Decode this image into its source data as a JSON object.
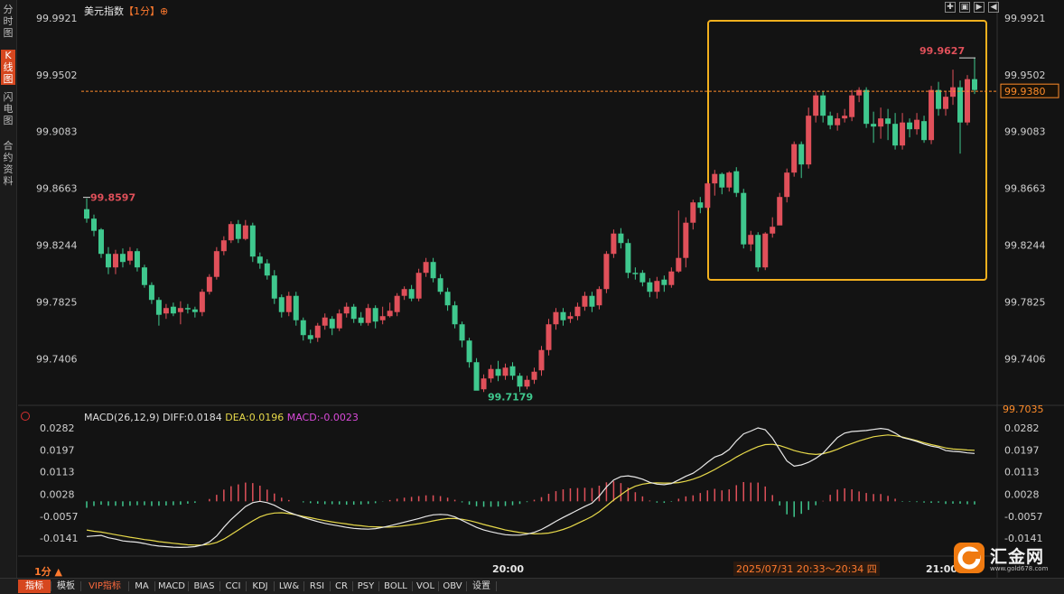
{
  "sidebar": {
    "tabs": [
      {
        "label": "分时图",
        "active": false
      },
      {
        "label": "K线图",
        "active": true
      },
      {
        "label": "闪电图",
        "active": false
      },
      {
        "label": "合约资料",
        "active": false
      }
    ]
  },
  "header": {
    "instrument": "美元指数",
    "period": "【1分】",
    "plus": "⊕"
  },
  "toolbar": {
    "icons": [
      "expand-icon",
      "shrink-icon",
      "play-icon",
      "previous-icon"
    ]
  },
  "price_axis": {
    "labels": [
      "99.9921",
      "99.9502",
      "99.9083",
      "99.8663",
      "99.8244",
      "99.7825",
      "99.7406"
    ],
    "last_price": "99.9380",
    "bottom_price": "99.7035"
  },
  "annotations": {
    "high": "99.9627",
    "mid_high": "99.8597",
    "low": "99.7179"
  },
  "macd": {
    "name": "MACD(26,12,9)",
    "diff": "DIFF:0.0184",
    "dea": "DEA:0.0196",
    "macd": "MACD:-0.0023",
    "axis_labels": [
      "0.0282",
      "0.0197",
      "0.0113",
      "0.0028",
      "-0.0057",
      "-0.0141"
    ]
  },
  "time_axis": {
    "labels": [
      "20:00",
      "21:00"
    ],
    "range": "2025/07/31 20:33～20:34 四",
    "period": "1分 ▲"
  },
  "bottom_bar": {
    "items": [
      "指标",
      "模板",
      "VIP指标",
      "MA",
      "MACD",
      "BIAS",
      "CCI",
      "KDJ",
      "LW&",
      "RSI",
      "CR",
      "PSY",
      "BOLL",
      "VOL",
      "OBV",
      "设置"
    ]
  },
  "logo": {
    "text": "汇金网",
    "url": "www.gold678.com"
  },
  "colors": {
    "up": "#e0505a",
    "down": "#3fc88e",
    "dashed_price": "#ff8c2a",
    "highlight_box": "#f2b01e",
    "diff_line": "#e8e8e8",
    "dea_line": "#e7d94a"
  },
  "chart_data": {
    "type": "candlestick",
    "price_range": [
      99.7035,
      99.9921
    ],
    "macd_range": [
      -0.0141,
      0.0282
    ],
    "candles": [
      [
        99.851,
        99.844,
        99.859,
        99.841
      ],
      [
        99.844,
        99.835,
        99.847,
        99.831
      ],
      [
        99.836,
        99.818,
        99.837,
        99.815
      ],
      [
        99.818,
        99.808,
        99.823,
        99.803
      ],
      [
        99.808,
        99.818,
        99.821,
        99.803
      ],
      [
        99.818,
        99.812,
        99.822,
        99.808
      ],
      [
        99.813,
        99.82,
        99.823,
        99.81
      ],
      [
        99.82,
        99.808,
        99.822,
        99.805
      ],
      [
        99.808,
        99.795,
        99.81,
        99.793
      ],
      [
        99.795,
        99.784,
        99.797,
        99.781
      ],
      [
        99.784,
        99.773,
        99.786,
        99.765
      ],
      [
        99.774,
        99.778,
        99.781,
        99.77
      ],
      [
        99.779,
        99.774,
        99.782,
        99.772
      ],
      [
        99.775,
        99.778,
        99.783,
        99.766
      ],
      [
        99.778,
        99.777,
        99.781,
        99.774
      ],
      [
        99.777,
        99.775,
        99.779,
        99.771
      ],
      [
        99.775,
        99.79,
        99.792,
        99.772
      ],
      [
        99.79,
        99.801,
        99.803,
        99.788
      ],
      [
        99.801,
        99.82,
        99.823,
        99.799
      ],
      [
        99.82,
        99.828,
        99.831,
        99.817
      ],
      [
        99.828,
        99.84,
        99.842,
        99.826
      ],
      [
        99.84,
        99.829,
        99.843,
        99.826
      ],
      [
        99.829,
        99.839,
        99.843,
        99.828
      ],
      [
        99.839,
        99.816,
        99.841,
        99.812
      ],
      [
        99.816,
        99.811,
        99.819,
        99.807
      ],
      [
        99.811,
        99.802,
        99.814,
        99.799
      ],
      [
        99.802,
        99.785,
        99.806,
        99.781
      ],
      [
        99.786,
        99.775,
        99.788,
        99.771
      ],
      [
        99.775,
        99.787,
        99.79,
        99.772
      ],
      [
        99.787,
        99.769,
        99.79,
        99.765
      ],
      [
        99.769,
        99.758,
        99.771,
        99.754
      ],
      [
        99.758,
        99.755,
        99.762,
        99.752
      ],
      [
        99.756,
        99.765,
        99.767,
        99.753
      ],
      [
        99.765,
        99.771,
        99.774,
        99.762
      ],
      [
        99.77,
        99.763,
        99.772,
        99.758
      ],
      [
        99.763,
        99.774,
        99.777,
        99.761
      ],
      [
        99.774,
        99.779,
        99.782,
        99.771
      ],
      [
        99.779,
        99.77,
        99.781,
        99.767
      ],
      [
        99.771,
        99.767,
        99.775,
        99.765
      ],
      [
        99.767,
        99.778,
        99.781,
        99.765
      ],
      [
        99.778,
        99.768,
        99.78,
        99.763
      ],
      [
        99.769,
        99.772,
        99.779,
        99.766
      ],
      [
        99.772,
        99.776,
        99.782,
        99.771
      ],
      [
        99.775,
        99.787,
        99.789,
        99.772
      ],
      [
        99.787,
        99.792,
        99.794,
        99.784
      ],
      [
        99.792,
        99.785,
        99.795,
        99.783
      ],
      [
        99.785,
        99.804,
        99.807,
        99.783
      ],
      [
        99.804,
        99.812,
        99.815,
        99.801
      ],
      [
        99.812,
        99.8,
        99.815,
        99.797
      ],
      [
        99.8,
        99.79,
        99.803,
        99.788
      ],
      [
        99.79,
        99.78,
        99.793,
        99.776
      ],
      [
        99.78,
        99.766,
        99.783,
        99.763
      ],
      [
        99.766,
        99.754,
        99.768,
        99.749
      ],
      [
        99.754,
        99.738,
        99.756,
        99.734
      ],
      [
        99.738,
        99.717,
        99.741,
        99.718
      ],
      [
        99.718,
        99.726,
        99.729,
        99.716
      ],
      [
        99.726,
        99.733,
        99.736,
        99.723
      ],
      [
        99.733,
        99.728,
        99.739,
        99.724
      ],
      [
        99.728,
        99.734,
        99.737,
        99.725
      ],
      [
        99.735,
        99.728,
        99.738,
        99.725
      ],
      [
        99.728,
        99.72,
        99.73,
        99.716
      ],
      [
        99.72,
        99.725,
        99.728,
        99.718
      ],
      [
        99.725,
        99.731,
        99.734,
        99.722
      ],
      [
        99.732,
        99.747,
        99.75,
        99.728
      ],
      [
        99.747,
        99.766,
        99.77,
        99.743
      ],
      [
        99.766,
        99.775,
        99.778,
        99.762
      ],
      [
        99.775,
        99.769,
        99.778,
        99.765
      ],
      [
        99.77,
        99.772,
        99.775,
        99.767
      ],
      [
        99.772,
        99.779,
        99.782,
        99.769
      ],
      [
        99.779,
        99.787,
        99.79,
        99.776
      ],
      [
        99.787,
        99.779,
        99.79,
        99.775
      ],
      [
        99.78,
        99.792,
        99.794,
        99.777
      ],
      [
        99.792,
        99.818,
        99.82,
        99.789
      ],
      [
        99.818,
        99.833,
        99.836,
        99.815
      ],
      [
        99.833,
        99.826,
        99.837,
        99.822
      ],
      [
        99.826,
        99.804,
        99.829,
        99.8
      ],
      [
        99.804,
        99.803,
        99.808,
        99.799
      ],
      [
        99.804,
        99.797,
        99.806,
        99.794
      ],
      [
        99.797,
        99.79,
        99.8,
        99.786
      ],
      [
        99.79,
        99.798,
        99.801,
        99.785
      ],
      [
        99.799,
        99.795,
        99.802,
        99.79
      ],
      [
        99.795,
        99.805,
        99.808,
        99.793
      ],
      [
        99.805,
        99.815,
        99.85,
        99.804
      ],
      [
        99.815,
        99.841,
        99.845,
        99.808
      ],
      [
        99.841,
        99.856,
        99.858,
        99.836
      ],
      [
        99.856,
        99.852,
        99.86,
        99.848
      ],
      [
        99.852,
        99.87,
        99.871,
        99.85
      ],
      [
        99.87,
        99.877,
        99.88,
        99.861
      ],
      [
        99.877,
        99.867,
        99.878,
        99.862
      ],
      [
        99.867,
        99.878,
        99.879,
        99.864
      ],
      [
        99.879,
        99.863,
        99.882,
        99.86
      ],
      [
        99.863,
        99.825,
        99.866,
        99.822
      ],
      [
        99.825,
        99.832,
        99.835,
        99.82
      ],
      [
        99.832,
        99.808,
        99.834,
        99.805
      ],
      [
        99.808,
        99.833,
        99.834,
        99.806
      ],
      [
        99.833,
        99.838,
        99.845,
        99.83
      ],
      [
        99.839,
        99.86,
        99.863,
        99.852
      ],
      [
        99.86,
        99.878,
        99.881,
        99.856
      ],
      [
        99.878,
        99.899,
        99.901,
        99.875
      ],
      [
        99.899,
        99.884,
        99.901,
        99.874
      ],
      [
        99.884,
        99.92,
        99.926,
        99.881
      ],
      [
        99.92,
        99.935,
        99.938,
        99.915
      ],
      [
        99.935,
        99.92,
        99.938,
        99.915
      ],
      [
        99.92,
        99.913,
        99.923,
        99.91
      ],
      [
        99.913,
        99.918,
        99.922,
        99.909
      ],
      [
        99.918,
        99.92,
        99.925,
        99.915
      ],
      [
        99.919,
        99.935,
        99.939,
        99.916
      ],
      [
        99.935,
        99.939,
        99.941,
        99.93
      ],
      [
        99.939,
        99.914,
        99.941,
        99.911
      ],
      [
        99.914,
        99.912,
        99.923,
        99.9
      ],
      [
        99.912,
        99.918,
        99.926,
        99.903
      ],
      [
        99.918,
        99.914,
        99.925,
        99.902
      ],
      [
        99.914,
        99.898,
        99.922,
        99.895
      ],
      [
        99.898,
        99.915,
        99.922,
        99.895
      ],
      [
        99.915,
        99.91,
        99.918,
        99.904
      ],
      [
        99.91,
        99.917,
        99.922,
        99.906
      ],
      [
        99.916,
        99.902,
        99.92,
        99.9
      ],
      [
        99.902,
        99.939,
        99.942,
        99.899
      ],
      [
        99.939,
        99.925,
        99.945,
        99.92
      ],
      [
        99.925,
        99.934,
        99.938,
        99.92
      ],
      [
        99.934,
        99.941,
        99.954,
        99.928
      ],
      [
        99.941,
        99.915,
        99.946,
        99.892
      ],
      [
        99.915,
        99.947,
        99.95,
        99.913
      ],
      [
        99.947,
        99.939,
        99.963,
        99.936
      ]
    ],
    "diff": [
      -0.0135,
      -0.0133,
      -0.0131,
      -0.014,
      -0.0145,
      -0.0152,
      -0.0155,
      -0.0157,
      -0.0162,
      -0.0168,
      -0.0172,
      -0.0174,
      -0.0176,
      -0.0177,
      -0.0176,
      -0.0174,
      -0.0168,
      -0.0156,
      -0.0133,
      -0.01,
      -0.007,
      -0.0045,
      -0.002,
      -0.0005,
      0.0,
      -0.0005,
      -0.0015,
      -0.003,
      -0.0042,
      -0.0052,
      -0.0062,
      -0.007,
      -0.0078,
      -0.0085,
      -0.009,
      -0.0095,
      -0.01,
      -0.0104,
      -0.0106,
      -0.0107,
      -0.0105,
      -0.01,
      -0.0094,
      -0.0087,
      -0.008,
      -0.0073,
      -0.0066,
      -0.0058,
      -0.0052,
      -0.005,
      -0.0052,
      -0.006,
      -0.0073,
      -0.0087,
      -0.01,
      -0.011,
      -0.0117,
      -0.0123,
      -0.0128,
      -0.013,
      -0.013,
      -0.0126,
      -0.0119,
      -0.0108,
      -0.0093,
      -0.0077,
      -0.0062,
      -0.0048,
      -0.0034,
      -0.002,
      -0.0007,
      0.002,
      0.0055,
      0.0082,
      0.0095,
      0.0098,
      0.0093,
      0.0085,
      0.0073,
      0.0066,
      0.0064,
      0.0068,
      0.0082,
      0.0096,
      0.0108,
      0.0127,
      0.015,
      0.017,
      0.018,
      0.0199,
      0.0232,
      0.0259,
      0.027,
      0.0282,
      0.0275,
      0.0243,
      0.0198,
      0.0155,
      0.0135,
      0.014,
      0.015,
      0.0165,
      0.0185,
      0.0215,
      0.0245,
      0.0262,
      0.0268,
      0.027,
      0.0272,
      0.0276,
      0.028,
      0.0276,
      0.0262,
      0.0245,
      0.0238,
      0.023,
      0.022,
      0.0212,
      0.0207,
      0.0195,
      0.0192,
      0.019,
      0.0186,
      0.0184
    ],
    "dea": [
      -0.011,
      -0.0115,
      -0.0118,
      -0.0123,
      -0.0128,
      -0.0133,
      -0.0138,
      -0.0142,
      -0.0147,
      -0.015,
      -0.0155,
      -0.0158,
      -0.0161,
      -0.0164,
      -0.0167,
      -0.0168,
      -0.0168,
      -0.0165,
      -0.0158,
      -0.0145,
      -0.0128,
      -0.011,
      -0.0092,
      -0.0075,
      -0.006,
      -0.005,
      -0.0045,
      -0.0044,
      -0.0047,
      -0.0052,
      -0.0058,
      -0.0063,
      -0.0069,
      -0.0074,
      -0.0079,
      -0.0083,
      -0.0087,
      -0.0091,
      -0.0094,
      -0.0097,
      -0.0098,
      -0.0099,
      -0.0099,
      -0.0097,
      -0.0094,
      -0.009,
      -0.0086,
      -0.0081,
      -0.0075,
      -0.007,
      -0.0066,
      -0.0066,
      -0.0069,
      -0.0074,
      -0.0081,
      -0.0089,
      -0.0096,
      -0.0103,
      -0.011,
      -0.0115,
      -0.012,
      -0.0123,
      -0.0125,
      -0.0124,
      -0.0122,
      -0.0116,
      -0.0108,
      -0.0098,
      -0.0085,
      -0.0072,
      -0.0058,
      -0.004,
      -0.0018,
      0.0005,
      0.0025,
      0.0045,
      0.0058,
      0.0066,
      0.007,
      0.0071,
      0.007,
      0.007,
      0.0072,
      0.0077,
      0.0085,
      0.0095,
      0.0108,
      0.0122,
      0.0138,
      0.0153,
      0.017,
      0.0185,
      0.0198,
      0.021,
      0.0218,
      0.0219,
      0.0214,
      0.0205,
      0.0195,
      0.0188,
      0.0183,
      0.018,
      0.0183,
      0.019,
      0.02,
      0.0212,
      0.0222,
      0.0232,
      0.024,
      0.0248,
      0.0252,
      0.0255,
      0.0252,
      0.0247,
      0.024,
      0.0233,
      0.0225,
      0.0218,
      0.0212,
      0.0205,
      0.0201,
      0.0199,
      0.0197,
      0.0196
    ],
    "macd_hist": [
      -0.0025,
      -0.0018,
      -0.0013,
      -0.0017,
      -0.0017,
      -0.0019,
      -0.0017,
      -0.0015,
      -0.0015,
      -0.0018,
      -0.0017,
      -0.0016,
      -0.0015,
      -0.0013,
      -0.0009,
      -0.0006,
      0.0,
      0.0009,
      0.0025,
      0.0045,
      0.0058,
      0.0065,
      0.0072,
      0.007,
      0.006,
      0.0045,
      0.003,
      0.0014,
      0.0005,
      -0.0,
      -0.0004,
      -0.0007,
      -0.0009,
      -0.0011,
      -0.0011,
      -0.0012,
      -0.0013,
      -0.0013,
      -0.0012,
      -0.001,
      -0.0007,
      -0.0001,
      0.0005,
      0.001,
      0.0014,
      0.0017,
      0.002,
      0.0023,
      0.0023,
      0.002,
      0.0014,
      0.0006,
      -0.0004,
      -0.0013,
      -0.0019,
      -0.0021,
      -0.0021,
      -0.002,
      -0.0018,
      -0.0015,
      -0.001,
      -0.0003,
      0.0006,
      0.0016,
      0.0029,
      0.0039,
      0.0046,
      0.005,
      0.0051,
      0.0052,
      0.0051,
      0.006,
      0.0073,
      0.0077,
      0.007,
      0.0053,
      0.0035,
      0.0019,
      0.0003,
      -0.0005,
      -0.0006,
      -0.0002,
      0.001,
      0.0019,
      0.0023,
      0.0032,
      0.0042,
      0.0048,
      0.0042,
      0.0046,
      0.0062,
      0.0074,
      0.0072,
      0.0072,
      0.0057,
      0.0024,
      -0.0016,
      -0.005,
      -0.006,
      -0.0048,
      -0.0033,
      -0.0015,
      0.0002,
      0.0025,
      0.0045,
      0.005,
      0.0046,
      0.0038,
      0.0032,
      0.0028,
      0.0028,
      0.0021,
      0.001,
      -0.0002,
      -0.0002,
      -0.0003,
      -0.0005,
      -0.0006,
      -0.0005,
      -0.001,
      -0.0009,
      -0.0009,
      -0.0011,
      -0.0012
    ]
  }
}
